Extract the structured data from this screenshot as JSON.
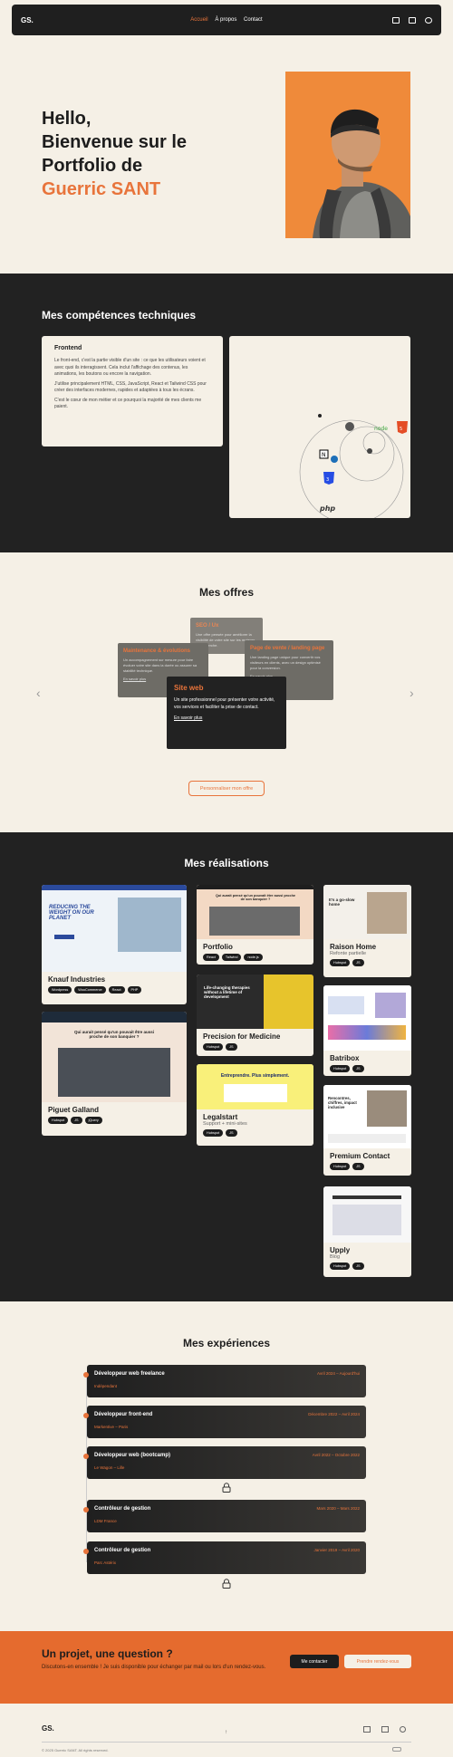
{
  "nav": {
    "logo": "GS.",
    "links": [
      "Accueil",
      "À propos",
      "Contact"
    ],
    "icons": [
      "mail-icon",
      "linkedin-icon",
      "github-icon"
    ],
    "accent": "#e8743b"
  },
  "hero": {
    "line1": "Hello,",
    "line2": "Bienvenue sur le",
    "line3": "Portfolio de",
    "name": "Guerric SANT"
  },
  "skills": {
    "title": "Mes compétences techniques",
    "card_title": "Frontend",
    "p1": "Le front-end, c'est la partie visible d'un site : ce que les utilisateurs voient et avec quoi ils interagissent. Cela inclut l'affichage des contenus, les animations, les boutons ou encore la navigation.",
    "p2": "J'utilise principalement HTML, CSS, JavaScript, React et Tailwind CSS pour créer des interfaces modernes, rapides et adaptées à tous les écrans.",
    "p3": "C'est le cœur de mon métier et ce pourquoi la majorité de mes clients me paient.",
    "logos": [
      "html5-logo",
      "css3-logo",
      "nodejs-logo",
      "php-logo",
      "notion-logo",
      "wordpress-logo"
    ],
    "php_label": "php"
  },
  "offers": {
    "title": "Mes offres",
    "back": {
      "title": "SEO / Ux",
      "text": "Une offre pensée pour améliorer la visibilité de votre site sur les moteurs de recherche."
    },
    "left": {
      "title": "Maintenance & évolutions",
      "text": "Un accompagnement sur mesure pour faire évoluer votre site dans la durée ou assurer sa stabilité technique.",
      "link": "En savoir plus"
    },
    "right": {
      "title": "Page de vente / landing page",
      "text": "Une landing page unique pour convertir vos visiteurs en clients, avec un design optimisé pour la conversion.",
      "link": "En savoir plus"
    },
    "main": {
      "title": "Site web",
      "text": "Un site professionnel pour présenter votre activité, vos services et faciliter la prise de contact.",
      "link": "En savoir plus"
    },
    "cta": "Personnaliser mon offre"
  },
  "projects": {
    "title": "Mes réalisations",
    "items": [
      {
        "name": "Knauf Industries",
        "sub": "",
        "tags": [
          "Wordpress",
          "WooCommerce",
          "React",
          "PHP"
        ]
      },
      {
        "name": "Piguet Galland",
        "sub": "",
        "tags": [
          "Hubspot",
          "JS",
          "jQuery"
        ]
      },
      {
        "name": "Portfolio",
        "sub": "",
        "tags": [
          "React",
          "Tailwind",
          "node.js"
        ]
      },
      {
        "name": "Precision for Medicine",
        "sub": "",
        "tags": [
          "Hubspot",
          "JS"
        ]
      },
      {
        "name": "Legalstart",
        "sub": "Support + mini-sites",
        "tags": [
          "Hubspot",
          "JS"
        ]
      },
      {
        "name": "Raison Home",
        "sub": "Refonte partielle",
        "tags": [
          "Hubspot",
          "JS"
        ]
      },
      {
        "name": "Batribox",
        "sub": "",
        "tags": [
          "Hubspot",
          "JS"
        ]
      },
      {
        "name": "Premium Contact",
        "sub": "",
        "tags": [
          "Hubspot",
          "JS"
        ]
      },
      {
        "name": "Upply",
        "sub": "Blog",
        "tags": [
          "Hubspot",
          "JS"
        ]
      }
    ],
    "shot_texts": {
      "knauf": "REDUCING THE WEIGHT ON OUR PLANET",
      "piguet": "Qui aurait pensé qu'un pouvait être aussi proche de son banquier ?",
      "portfolio": "Qui aurait pensé qu'un pouvait être aussi proche de son banquier ?",
      "precision": "Life-changing therapies without a lifetime of development",
      "legalstart": "Entreprendre. Plus simplement.",
      "raison": "It's a go-slow home",
      "premium": "Rencontres, chiffres, impact inclusive"
    }
  },
  "experiences": {
    "title": "Mes expériences",
    "items": [
      {
        "title": "Développeur web freelance",
        "date": "Avril 2024 – Aujourd'hui",
        "company": "Indépendant"
      },
      {
        "title": "Développeur front-end",
        "date": "Décembre 2022 – Avril 2024",
        "company": "Markentive – Paris"
      },
      {
        "title": "Développeur web (bootcamp)",
        "date": "Avril 2022 – Octobre 2022",
        "company": "Le Wagon – Lille"
      },
      {
        "title": "Contrôleur de gestion",
        "date": "Mars 2020 – Mars 2022",
        "company": "LDM France"
      },
      {
        "title": "Contrôleur de gestion",
        "date": "Janvier 2019 – Avril 2020",
        "company": "Parc Astérix"
      }
    ]
  },
  "cta": {
    "title": "Un projet, une question ?",
    "text": "Discutons-en ensemble ! Je suis disponible pour échanger par mail ou lors d'un rendez-vous.",
    "contact": "Me contacter",
    "meeting": "Prendre rendez-vous"
  },
  "footer": {
    "logo": "GS.",
    "copyright": "© 2025 Guerric SANT. All rights reserved.",
    "icons": [
      "mail-icon",
      "linkedin-icon",
      "github-icon"
    ]
  }
}
